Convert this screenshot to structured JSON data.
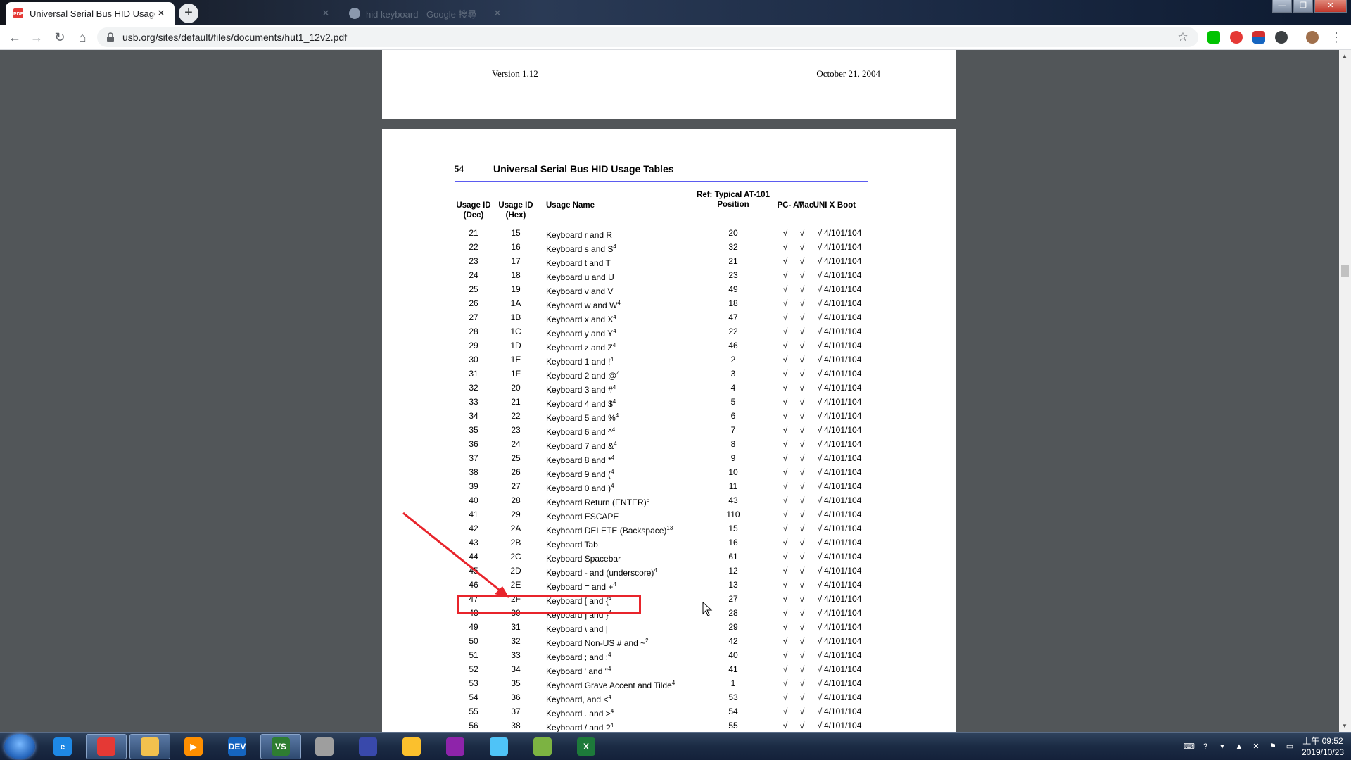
{
  "browser": {
    "tabs": [
      {
        "title": "Universal Serial Bus HID Usage",
        "close": "✕"
      },
      {
        "title": "",
        "close": "✕"
      },
      {
        "title": "hid keyboard - Google 搜尋",
        "close": "✕"
      }
    ],
    "new_tab": "+",
    "url": "usb.org/sites/default/files/documents/hut1_12v2.pdf",
    "window_controls": {
      "minimize": "—",
      "maximize": "❐",
      "close": "✕"
    }
  },
  "document": {
    "prev_page": {
      "version": "Version 1.12",
      "date": "October 21, 2004"
    },
    "page_number": "54",
    "page_heading": "Universal Serial Bus HID Usage Tables",
    "headers": {
      "usage_id_dec": "Usage ID (Dec)",
      "usage_id_hex": "Usage ID (Hex)",
      "usage_name": "Usage Name",
      "ref_position": "Ref: Typical AT-101 Position",
      "pc_at": "PC- AT",
      "mac": "Mac",
      "unix": "UNI X",
      "boot": "Boot"
    },
    "rows": [
      {
        "dec": "21",
        "hex": "15",
        "name": "Keyboard r and R",
        "sup": "",
        "ref": "20"
      },
      {
        "dec": "22",
        "hex": "16",
        "name": "Keyboard s and S",
        "sup": "4",
        "ref": "32"
      },
      {
        "dec": "23",
        "hex": "17",
        "name": "Keyboard t and T",
        "sup": "",
        "ref": "21"
      },
      {
        "dec": "24",
        "hex": "18",
        "name": "Keyboard u and U",
        "sup": "",
        "ref": "23"
      },
      {
        "dec": "25",
        "hex": "19",
        "name": "Keyboard v and V",
        "sup": "",
        "ref": "49"
      },
      {
        "dec": "26",
        "hex": "1A",
        "name": "Keyboard w and W",
        "sup": "4",
        "ref": "18"
      },
      {
        "dec": "27",
        "hex": "1B",
        "name": "Keyboard x and X",
        "sup": "4",
        "ref": "47"
      },
      {
        "dec": "28",
        "hex": "1C",
        "name": "Keyboard y and Y",
        "sup": "4",
        "ref": "22"
      },
      {
        "dec": "29",
        "hex": "1D",
        "name": "Keyboard z and Z",
        "sup": "4",
        "ref": "46"
      },
      {
        "dec": "30",
        "hex": "1E",
        "name": "Keyboard 1 and !",
        "sup": "4",
        "ref": "2"
      },
      {
        "dec": "31",
        "hex": "1F",
        "name": "Keyboard 2 and @",
        "sup": "4",
        "ref": "3"
      },
      {
        "dec": "32",
        "hex": "20",
        "name": "Keyboard 3 and #",
        "sup": "4",
        "ref": "4"
      },
      {
        "dec": "33",
        "hex": "21",
        "name": "Keyboard 4 and $",
        "sup": "4",
        "ref": "5"
      },
      {
        "dec": "34",
        "hex": "22",
        "name": "Keyboard 5 and %",
        "sup": "4",
        "ref": "6"
      },
      {
        "dec": "35",
        "hex": "23",
        "name": "Keyboard 6 and ^",
        "sup": "4",
        "ref": "7"
      },
      {
        "dec": "36",
        "hex": "24",
        "name": "Keyboard 7 and &",
        "sup": "4",
        "ref": "8"
      },
      {
        "dec": "37",
        "hex": "25",
        "name": "Keyboard 8 and *",
        "sup": "4",
        "ref": "9"
      },
      {
        "dec": "38",
        "hex": "26",
        "name": "Keyboard 9 and (",
        "sup": "4",
        "ref": "10"
      },
      {
        "dec": "39",
        "hex": "27",
        "name": "Keyboard 0 and )",
        "sup": "4",
        "ref": "11"
      },
      {
        "dec": "40",
        "hex": "28",
        "name": "Keyboard Return (ENTER)",
        "sup": "5",
        "ref": "43"
      },
      {
        "dec": "41",
        "hex": "29",
        "name": "Keyboard ESCAPE",
        "sup": "",
        "ref": "110"
      },
      {
        "dec": "42",
        "hex": "2A",
        "name": "Keyboard DELETE (Backspace)",
        "sup": "13",
        "ref": "15"
      },
      {
        "dec": "43",
        "hex": "2B",
        "name": "Keyboard Tab",
        "sup": "",
        "ref": "16"
      },
      {
        "dec": "44",
        "hex": "2C",
        "name": "Keyboard Spacebar",
        "sup": "",
        "ref": "61"
      },
      {
        "dec": "45",
        "hex": "2D",
        "name": "Keyboard - and (underscore)",
        "sup": "4",
        "ref": "12"
      },
      {
        "dec": "46",
        "hex": "2E",
        "name": "Keyboard = and +",
        "sup": "4",
        "ref": "13"
      },
      {
        "dec": "47",
        "hex": "2F",
        "name": "Keyboard [ and {",
        "sup": "4",
        "ref": "27"
      },
      {
        "dec": "48",
        "hex": "30",
        "name": "Keyboard ] and }",
        "sup": "4",
        "ref": "28"
      },
      {
        "dec": "49",
        "hex": "31",
        "name": "Keyboard \\ and |",
        "sup": "",
        "ref": "29"
      },
      {
        "dec": "50",
        "hex": "32",
        "name": "Keyboard Non-US # and ~",
        "sup": "2",
        "ref": "42"
      },
      {
        "dec": "51",
        "hex": "33",
        "name": "Keyboard ; and :",
        "sup": "4",
        "ref": "40"
      },
      {
        "dec": "52",
        "hex": "34",
        "name": "Keyboard ' and \"",
        "sup": "4",
        "ref": "41"
      },
      {
        "dec": "53",
        "hex": "35",
        "name": "Keyboard Grave Accent and Tilde",
        "sup": "4",
        "ref": "1"
      },
      {
        "dec": "54",
        "hex": "36",
        "name": "Keyboard, and <",
        "sup": "4",
        "ref": "53"
      },
      {
        "dec": "55",
        "hex": "37",
        "name": "Keyboard . and >",
        "sup": "4",
        "ref": "54"
      },
      {
        "dec": "56",
        "hex": "38",
        "name": "Keyboard / and ?",
        "sup": "4",
        "ref": "55"
      }
    ],
    "check_mark": "√",
    "boot_value": "4/101/104",
    "highlight_color": "#e8242b"
  },
  "taskbar": {
    "apps": [
      {
        "name": "internet-explorer",
        "glyph": "e",
        "color": "#1e88e5"
      },
      {
        "name": "chrome",
        "glyph": "",
        "color": "#e53935"
      },
      {
        "name": "file-explorer",
        "glyph": "",
        "color": "#f2c14e"
      },
      {
        "name": "media-player",
        "glyph": "▶",
        "color": "#ff8f00"
      },
      {
        "name": "devcpp",
        "glyph": "DEV",
        "color": "#1565c0"
      },
      {
        "name": "visual-studio",
        "glyph": "VS",
        "color": "#2e7d32"
      },
      {
        "name": "virtualbox",
        "glyph": "",
        "color": "#9e9e9e"
      },
      {
        "name": "vpn-client",
        "glyph": "",
        "color": "#3949ab"
      },
      {
        "name": "network-tool",
        "glyph": "",
        "color": "#fbc02d"
      },
      {
        "name": "paint",
        "glyph": "",
        "color": "#8e24aa"
      },
      {
        "name": "notes",
        "glyph": "",
        "color": "#4fc3f7"
      },
      {
        "name": "chart-tool",
        "glyph": "",
        "color": "#7cb342"
      },
      {
        "name": "excel",
        "glyph": "X",
        "color": "#1d7a3a"
      }
    ],
    "clock_time": "上午 09:52",
    "clock_date": "2019/10/23"
  }
}
